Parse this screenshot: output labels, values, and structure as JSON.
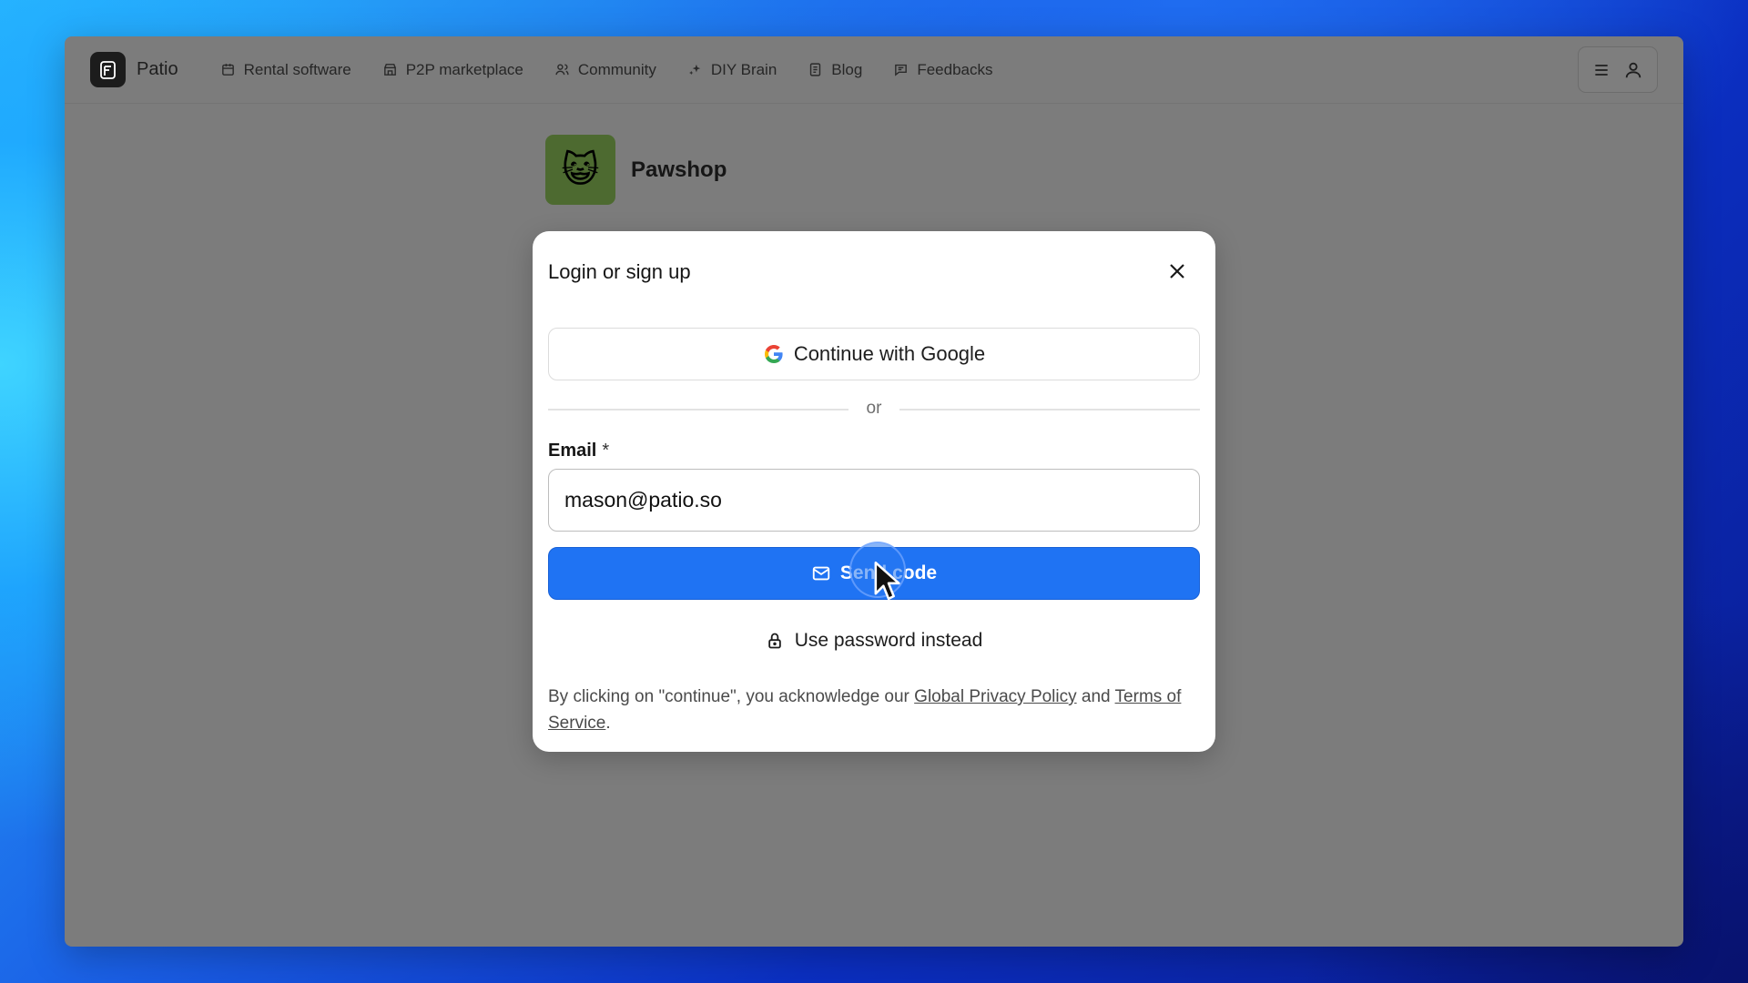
{
  "app": {
    "brand_name": "Patio",
    "logo_icon": "patio-logo-icon"
  },
  "nav": {
    "items": [
      {
        "label": "Rental software",
        "icon": "calendar-icon"
      },
      {
        "label": "P2P marketplace",
        "icon": "store-icon"
      },
      {
        "label": "Community",
        "icon": "users-icon"
      },
      {
        "label": "DIY Brain",
        "icon": "sparkle-icon"
      },
      {
        "label": "Blog",
        "icon": "document-icon"
      },
      {
        "label": "Feedbacks",
        "icon": "message-icon"
      }
    ],
    "right": {
      "menu_icon": "hamburger-icon",
      "account_icon": "user-icon"
    }
  },
  "shop": {
    "name": "Pawshop",
    "avatar_emoji": "😺"
  },
  "modal": {
    "title": "Login or sign up",
    "google_button": "Continue with Google",
    "divider_text": "or",
    "email_label": "Email",
    "email_required_marker": "*",
    "email_value": "mason@patio.so",
    "send_button": "Send code",
    "password_link": "Use password instead",
    "legal": {
      "prefix": "By clicking on \"continue\", you acknowledge our ",
      "privacy_link": "Global Privacy Policy",
      "middle": " and ",
      "terms_link": "Terms of Service",
      "suffix": "."
    }
  },
  "colors": {
    "primary": "#1f73f3",
    "overlay": "#7c7c7c",
    "shop_avatar_bg": "#4d6a30"
  }
}
